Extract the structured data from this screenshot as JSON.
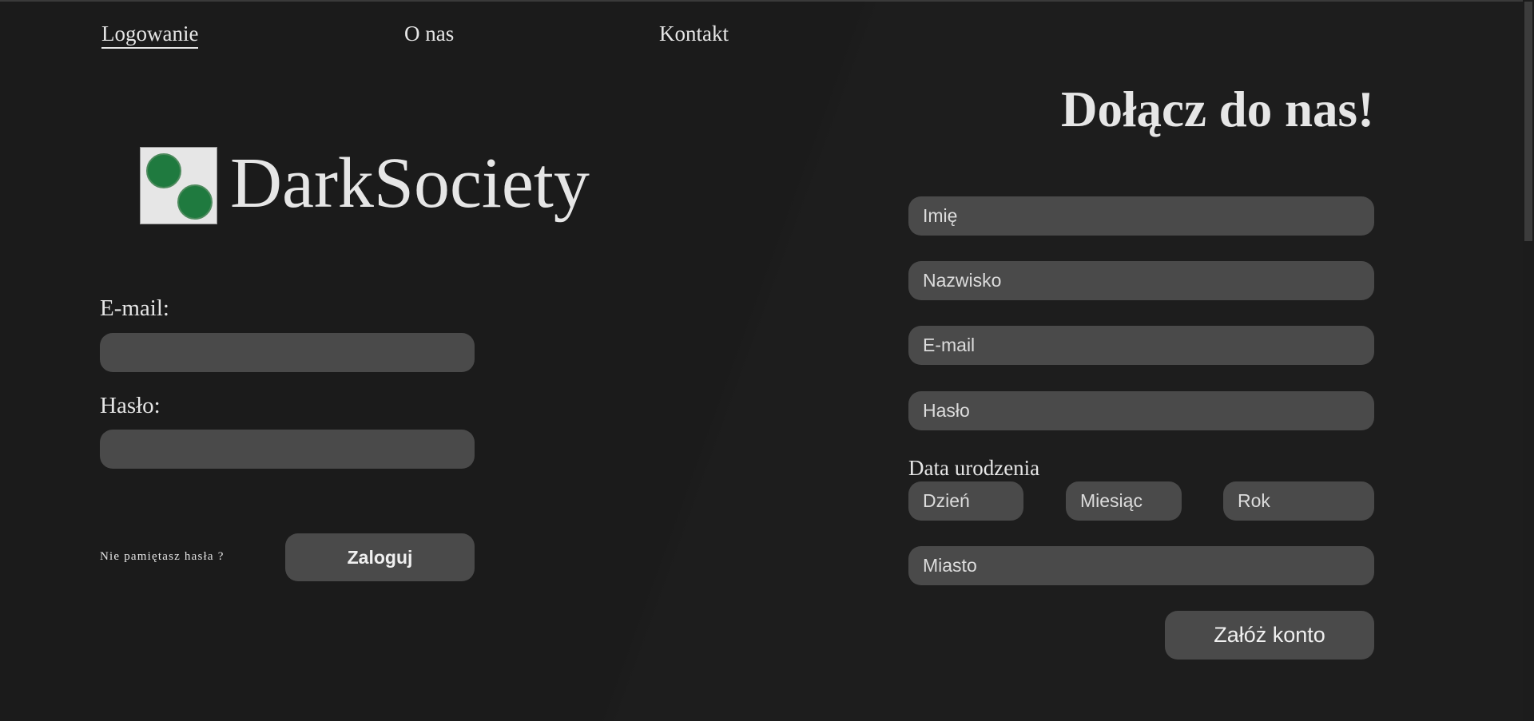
{
  "nav": {
    "items": [
      {
        "label": "Logowanie",
        "active": true
      },
      {
        "label": "O nas",
        "active": false
      },
      {
        "label": "Kontakt",
        "active": false
      }
    ]
  },
  "logo": {
    "text": "DarkSociety",
    "icon": "two-green-dots-logo-icon",
    "dot_color": "#1f7a3f"
  },
  "login": {
    "email_label": "E-mail:",
    "email_value": "",
    "password_label": "Hasło:",
    "password_value": "",
    "forgot_link": "Nie pamiętasz hasła ?",
    "submit_label": "Zaloguj"
  },
  "register": {
    "title": "Dołącz do nas!",
    "first_name_placeholder": "Imię",
    "last_name_placeholder": "Nazwisko",
    "email_placeholder": "E-mail",
    "password_placeholder": "Hasło",
    "dob_label": "Data urodzenia",
    "day_placeholder": "Dzień",
    "month_placeholder": "Miesiąc",
    "year_placeholder": "Rok",
    "city_placeholder": "Miasto",
    "submit_label": "Załóż konto"
  },
  "colors": {
    "background": "#1a1a1a",
    "field": "#4a4a4a",
    "text": "#e6e6e6",
    "accent": "#1f7a3f"
  }
}
